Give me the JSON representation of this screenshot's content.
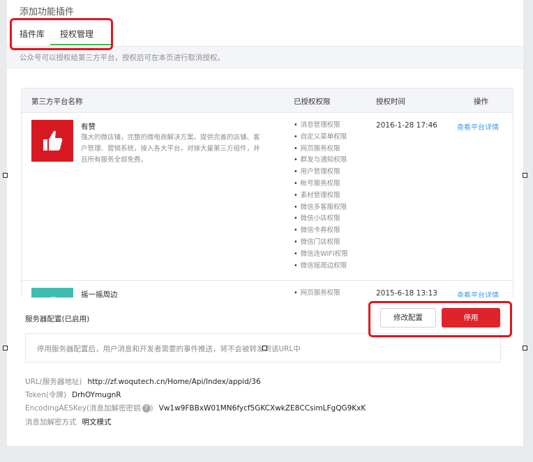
{
  "page": {
    "title": "添加功能插件"
  },
  "tabs": [
    {
      "label": "插件库",
      "active": false
    },
    {
      "label": "授权管理",
      "active": true
    }
  ],
  "notice": "公众号可以授权给第三方平台，授权后可在本页进行取消授权。",
  "table": {
    "headers": {
      "name": "第三方平台名称",
      "perms": "已授权权限",
      "time": "授权时间",
      "action": "操作"
    },
    "rows": [
      {
        "name": "有赞",
        "description": "强大的微店铺，完整的微电商解决方案。提供完善的店铺、客户管理、营销系统，接入各大平台，对接大量第三方组件，并且所有服务全部免费。",
        "icon": "thumbs-up-icon",
        "icon_color": "#d71a21",
        "permissions": [
          "消息管理权限",
          "自定义菜单权限",
          "网页服务权限",
          "群发与通知权限",
          "用户管理权限",
          "帐号服务权限",
          "素材管理权限",
          "微信多客服权限",
          "微信小店权限",
          "微信卡券权限",
          "微信门店权限",
          "微信连WIFI权限",
          "微信摇周边权限"
        ],
        "time": "2016-1-28 17:46",
        "action": "查看平台详情"
      },
      {
        "name": "摇一摇周边",
        "icon": "shake-icon",
        "icon_color": "#3fbcb2",
        "permissions": [
          "网页服务权限"
        ],
        "time": "2015-6-18 13:13",
        "action": "查看平台详情"
      }
    ]
  },
  "server": {
    "title": "服务器配置(已启用)",
    "modify_label": "修改配置",
    "disable_label": "停用",
    "warning": "停用服务器配置后，用户消息和开发者需要的事件推送，将不会被转发到该URL中",
    "url_key": "URL(服务器地址)",
    "url_value": "http://zf.woqutech.cn/Home/Api/Index/appid/36",
    "token_key": "Token(令牌)",
    "token_value": "DrhOYmugnR",
    "aes_key": "EncodingAESKey(消息加解密密钥",
    "aes_value": "Vw1w9FBBxW01MN6fycf5GKCXwkZE8CCsimLFgQG9KxK",
    "encrypt_key": "消息加解密方式",
    "encrypt_value": "明文模式"
  },
  "colors": {
    "accent_green": "#44b549",
    "danger_red": "#e0232b",
    "link_blue": "#459ae9",
    "highlight_red": "#e4141b"
  }
}
